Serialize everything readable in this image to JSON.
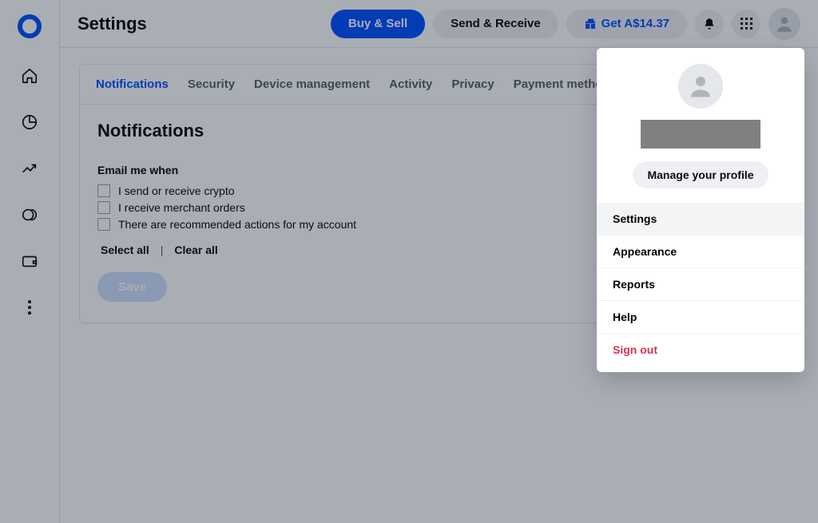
{
  "page_title": "Settings",
  "topbar": {
    "buy_sell": "Buy & Sell",
    "send_receive": "Send & Receive",
    "promo": "Get A$14.37"
  },
  "tabs": [
    "Notifications",
    "Security",
    "Device management",
    "Activity",
    "Privacy",
    "Payment methods"
  ],
  "section": {
    "heading": "Notifications",
    "subheading": "Email me when",
    "options": [
      "I send or receive crypto",
      "I receive merchant orders",
      "There are recommended actions for my account"
    ],
    "select_all": "Select all",
    "clear_all": "Clear all",
    "save": "Save"
  },
  "profile_menu": {
    "manage": "Manage your profile",
    "items": [
      "Settings",
      "Appearance",
      "Reports",
      "Help"
    ],
    "sign_out": "Sign out"
  }
}
